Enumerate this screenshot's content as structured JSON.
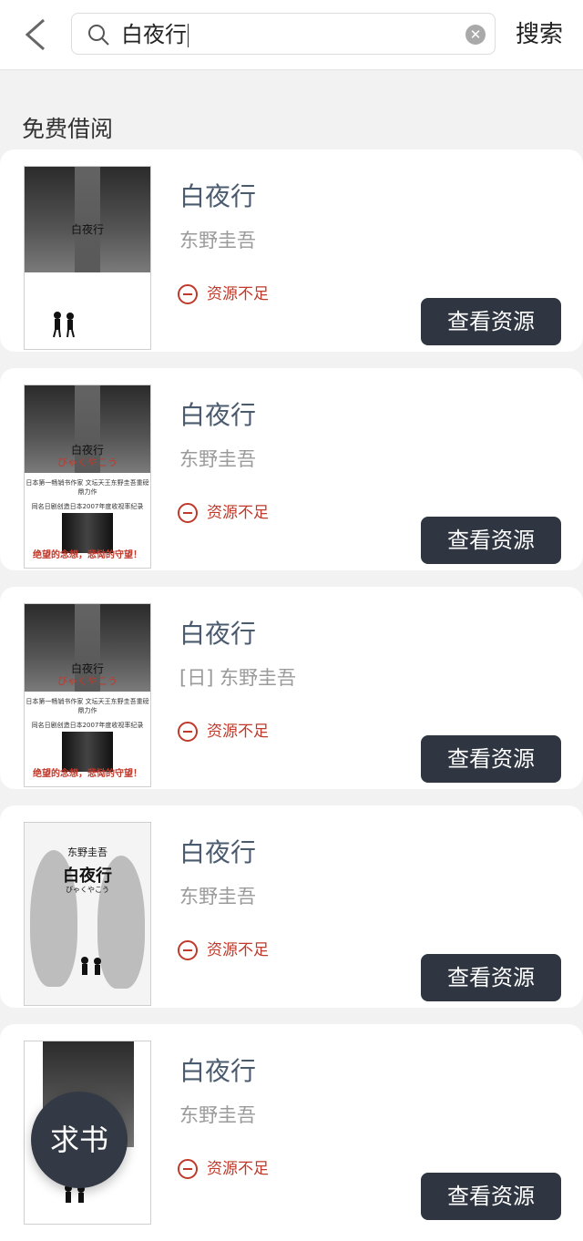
{
  "header": {
    "search_value": "白夜行",
    "search_button": "搜索"
  },
  "section": {
    "title": "免费借阅"
  },
  "books": [
    {
      "title": "白夜行",
      "author": "东野圭吾",
      "status": "资源不足",
      "action": "查看资源"
    },
    {
      "title": "白夜行",
      "author": "东野圭吾",
      "status": "资源不足",
      "action": "查看资源"
    },
    {
      "title": "白夜行",
      "author": "[日] 东野圭吾",
      "status": "资源不足",
      "action": "查看资源"
    },
    {
      "title": "白夜行",
      "author": "东野圭吾",
      "status": "资源不足",
      "action": "查看资源"
    },
    {
      "title": "白夜行",
      "author": "东野圭吾",
      "status": "资源不足",
      "action": "查看资源"
    }
  ],
  "covers": {
    "cover1": {
      "title": "白夜行"
    },
    "cover2": {
      "title": "白夜行",
      "kana": "びゃくやこう",
      "tagline": "日本第一畅销书作家 文坛天王东野圭吾重磅鼎力作",
      "caption": "同名日剧创造日本2007年度收视率纪录",
      "slogan": "绝望的念想，悲恸的守望！"
    },
    "cover3": {
      "title": "白夜行",
      "kana": "びゃくやこう",
      "tagline": "日本第一畅销书作家 文坛天王东野圭吾重磅鼎力作",
      "caption": "同名日剧创造日本2007年度收视率纪录",
      "slogan": "绝望的念想，悲恸的守望！"
    },
    "cover4": {
      "author": "东野圭吾",
      "title": "白夜行",
      "kana": "びゃくやこう"
    }
  },
  "fab": {
    "label": "求书"
  },
  "colors": {
    "accent_button": "#2f3541",
    "status_red": "#c0392b",
    "title_blue": "#4a5b70"
  }
}
